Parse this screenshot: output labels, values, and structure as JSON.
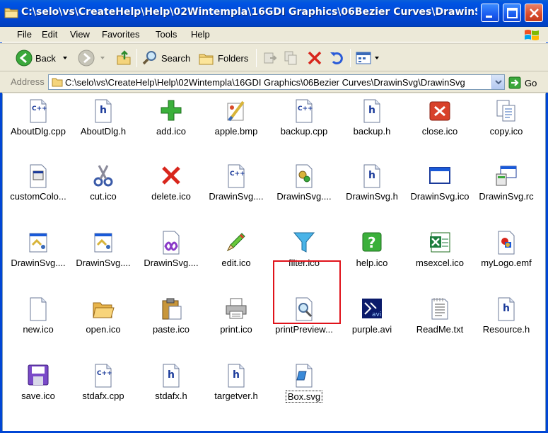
{
  "window": {
    "title": "C:\\selo\\vs\\CreateHelp\\Help\\02Wintempla\\16GDI Graphics\\06Bezier Curves\\DrawinSvg..."
  },
  "menu": [
    "File",
    "Edit",
    "View",
    "Favorites",
    "Tools",
    "Help"
  ],
  "toolbar": {
    "back": "Back",
    "search": "Search",
    "folders": "Folders"
  },
  "address": {
    "label": "Address",
    "value": "C:\\selo\\vs\\CreateHelp\\Help\\02Wintempla\\16GDI Graphics\\06Bezier Curves\\DrawinSvg\\DrawinSvg",
    "go": "Go"
  },
  "files": [
    {
      "name": "AboutDlg.cpp",
      "icon": "cpp-file-icon"
    },
    {
      "name": "AboutDlg.h",
      "icon": "h-file-icon"
    },
    {
      "name": "add.ico",
      "icon": "green-plus-icon"
    },
    {
      "name": "apple.bmp",
      "icon": "paint-bitmap-icon"
    },
    {
      "name": "backup.cpp",
      "icon": "cpp-file-icon"
    },
    {
      "name": "backup.h",
      "icon": "h-file-icon"
    },
    {
      "name": "close.ico",
      "icon": "red-close-icon"
    },
    {
      "name": "copy.ico",
      "icon": "copy-pages-icon"
    },
    {
      "name": "customColo...",
      "icon": "dialog-file-icon"
    },
    {
      "name": "cut.ico",
      "icon": "scissors-icon"
    },
    {
      "name": "delete.ico",
      "icon": "red-x-icon"
    },
    {
      "name": "DrawinSvg....",
      "icon": "cpp-file-icon"
    },
    {
      "name": "DrawinSvg....",
      "icon": "settings-file-icon"
    },
    {
      "name": "DrawinSvg.h",
      "icon": "h-file-icon"
    },
    {
      "name": "DrawinSvg.ico",
      "icon": "window-frame-icon"
    },
    {
      "name": "DrawinSvg.rc",
      "icon": "resource-script-icon"
    },
    {
      "name": "DrawinSvg....",
      "icon": "project-file-icon"
    },
    {
      "name": "DrawinSvg....",
      "icon": "project-file-icon"
    },
    {
      "name": "DrawinSvg....",
      "icon": "vs-solution-icon"
    },
    {
      "name": "edit.ico",
      "icon": "pencil-icon"
    },
    {
      "name": "filter.ico",
      "icon": "funnel-icon"
    },
    {
      "name": "help.ico",
      "icon": "green-help-icon"
    },
    {
      "name": "msexcel.ico",
      "icon": "excel-icon"
    },
    {
      "name": "myLogo.emf",
      "icon": "emf-picture-icon"
    },
    {
      "name": "new.ico",
      "icon": "blank-page-icon"
    },
    {
      "name": "open.ico",
      "icon": "open-folder-icon"
    },
    {
      "name": "paste.ico",
      "icon": "clipboard-icon"
    },
    {
      "name": "print.ico",
      "icon": "printer-icon"
    },
    {
      "name": "printPreview...",
      "icon": "print-preview-icon"
    },
    {
      "name": "purple.avi",
      "icon": "video-file-icon"
    },
    {
      "name": "ReadMe.txt",
      "icon": "text-file-icon"
    },
    {
      "name": "Resource.h",
      "icon": "h-file-icon"
    },
    {
      "name": "save.ico",
      "icon": "floppy-disk-icon"
    },
    {
      "name": "stdafx.cpp",
      "icon": "cpp-file-icon"
    },
    {
      "name": "stdafx.h",
      "icon": "h-file-icon"
    },
    {
      "name": "targetver.h",
      "icon": "h-file-icon"
    },
    {
      "name": "Box.svg",
      "icon": "svg-file-icon",
      "selected": true
    }
  ],
  "colors": {
    "titlebar": "#0054e3",
    "highlight": "#e0121a"
  }
}
